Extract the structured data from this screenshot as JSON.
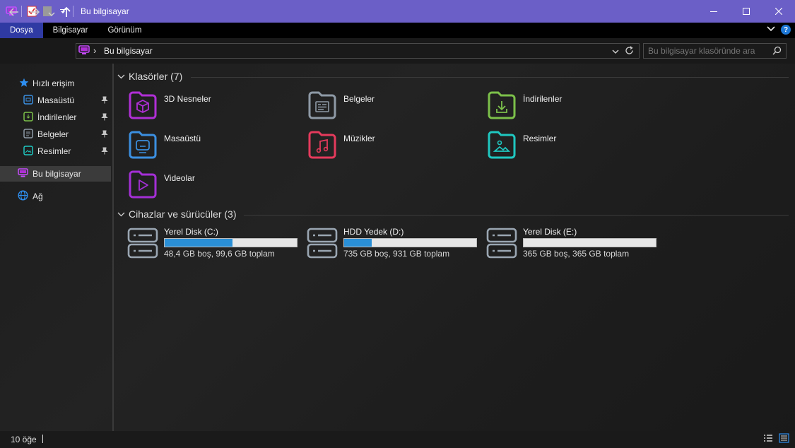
{
  "window": {
    "title": "Bu bilgisayar"
  },
  "ribbon": {
    "tabs": [
      "Dosya",
      "Bilgisayar",
      "Görünüm"
    ],
    "active": "Dosya"
  },
  "address": {
    "path_item": "Bu bilgisayar",
    "separator": "›"
  },
  "search": {
    "placeholder": "Bu bilgisayar klasöründe ara"
  },
  "sidebar": {
    "quick_access": "Hızlı erişim",
    "pinned": [
      {
        "label": "Masaüstü",
        "icon": "desktop-folder-icon",
        "color": "#3b8fe0"
      },
      {
        "label": "İndirilenler",
        "icon": "downloads-folder-icon",
        "color": "#7cc04a"
      },
      {
        "label": "Belgeler",
        "icon": "documents-folder-icon",
        "color": "#8e9aa6"
      },
      {
        "label": "Resimler",
        "icon": "pictures-folder-icon",
        "color": "#1fc7c0"
      }
    ],
    "this_pc": "Bu bilgisayar",
    "network": "Ağ"
  },
  "folders_section": {
    "title": "Klasörler (7)"
  },
  "folders": [
    {
      "label": "3D Nesneler",
      "icon": "3d-objects-folder-icon",
      "color": "#b02fd6"
    },
    {
      "label": "Belgeler",
      "icon": "documents-folder-icon",
      "color": "#8e9aa6"
    },
    {
      "label": "İndirilenler",
      "icon": "downloads-folder-icon",
      "color": "#7cc04a"
    },
    {
      "label": "Masaüstü",
      "icon": "desktop-folder-icon",
      "color": "#3b8fe0"
    },
    {
      "label": "Müzikler",
      "icon": "music-folder-icon",
      "color": "#e53a5c"
    },
    {
      "label": "Resimler",
      "icon": "pictures-folder-icon",
      "color": "#1fc7c0"
    },
    {
      "label": "Videolar",
      "icon": "videos-folder-icon",
      "color": "#a42fd6"
    }
  ],
  "drives_section": {
    "title": "Cihazlar ve sürücüler (3)"
  },
  "drives": [
    {
      "name": "Yerel Disk (C:)",
      "info": "48,4 GB boş, 99,6 GB toplam",
      "used_fraction": 0.514
    },
    {
      "name": "HDD Yedek (D:)",
      "info": "735 GB boş, 931 GB toplam",
      "used_fraction": 0.21
    },
    {
      "name": "Yerel Disk (E:)",
      "info": "365 GB boş, 365 GB toplam",
      "used_fraction": 0.0
    }
  ],
  "status": {
    "item_count": "10 öğe"
  },
  "colors": {
    "titlebar": "#6b5fc7",
    "ribbon_active": "#2f3aa3",
    "bar_fill": "#2a8fd6",
    "this_pc_icon": "#b02fd6"
  }
}
